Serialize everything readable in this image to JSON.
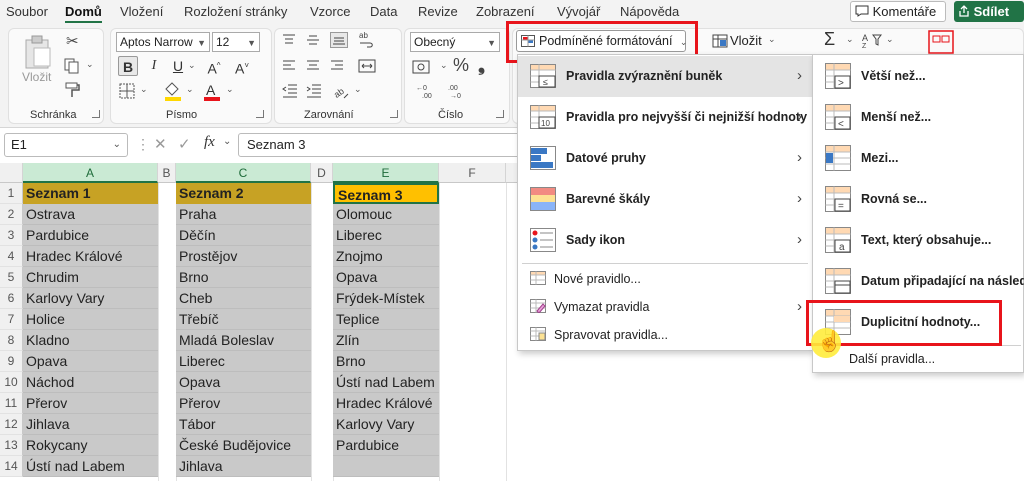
{
  "menubar": {
    "tabs": [
      "Soubor",
      "Domů",
      "Vložení",
      "Rozložení stránky",
      "Vzorce",
      "Data",
      "Revize",
      "Zobrazení",
      "Vývojář",
      "Nápověda"
    ],
    "active_tab": "Domů",
    "comments": "Komentáře",
    "share": "Sdílet"
  },
  "ribbon": {
    "groups": {
      "clipboard": "Schránka",
      "font": "Písmo",
      "alignment": "Zarovnání",
      "number": "Číslo"
    },
    "paste_label": "Vložit",
    "font_name": "Aptos Narrow",
    "font_size": "12",
    "number_format": "Obecný",
    "conditional_formatting": "Podmíněné formátování",
    "insert": "Vložit",
    "percent": "%"
  },
  "formula_bar": {
    "name_box": "E1",
    "fx": "fx",
    "content": "Seznam 3"
  },
  "columns": [
    "A",
    "B",
    "C",
    "D",
    "E",
    "F"
  ],
  "rows": [
    "1",
    "2",
    "3",
    "4",
    "5",
    "6",
    "7",
    "8",
    "9",
    "10",
    "11",
    "12",
    "13",
    "14"
  ],
  "list1": [
    "Seznam 1",
    "Ostrava",
    "Pardubice",
    "Hradec Králové",
    "Chrudim",
    "Karlovy Vary",
    "Holice",
    "Kladno",
    "Opava",
    "Náchod",
    "Přerov",
    "Jihlava",
    "Rokycany",
    "Ústí nad Labem"
  ],
  "list2": [
    "Seznam 2",
    "Praha",
    "Děčín",
    "Prostějov",
    "Brno",
    "Cheb",
    "Třebíč",
    "Mladá Boleslav",
    "Liberec",
    "Opava",
    "Přerov",
    "Tábor",
    "České Budějovice",
    "Jihlava"
  ],
  "list3": [
    "Seznam 3",
    "Olomouc",
    "Liberec",
    "Znojmo",
    "Opava",
    "Frýdek-Místek",
    "Teplice",
    "Zlín",
    "Brno",
    "Ústí nad Labem",
    "Hradec Králové",
    "Karlovy Vary",
    "Pardubice"
  ],
  "cf_menu": {
    "items": [
      {
        "label": "Pravidla zvýraznění buněk",
        "has_submenu": true,
        "highlighted": true
      },
      {
        "label": "Pravidla pro nejvyšší či nejnižší hodnoty",
        "has_submenu": true
      },
      {
        "label": "Datové pruhy",
        "has_submenu": true
      },
      {
        "label": "Barevné škály",
        "has_submenu": true
      },
      {
        "label": "Sady ikon",
        "has_submenu": true
      }
    ],
    "actions": [
      {
        "label": "Nové pravidlo..."
      },
      {
        "label": "Vymazat pravidla",
        "has_submenu": true
      },
      {
        "label": "Spravovat pravidla..."
      }
    ]
  },
  "highlight_submenu": {
    "items": [
      {
        "label": "Větší než..."
      },
      {
        "label": "Menší než..."
      },
      {
        "label": "Mezi..."
      },
      {
        "label": "Rovná se..."
      },
      {
        "label": "Text, který obsahuje..."
      },
      {
        "label": "Datum připadající na následující..."
      },
      {
        "label": "Duplicitní hodnoty...",
        "selected": true
      }
    ],
    "more": "Další pravidla..."
  },
  "colors": {
    "accent": "#217346",
    "highlight_red": "#e8141b",
    "header1_fill": "#c7a224",
    "header3_fill": "#ffc000",
    "data_fill": "#c9c9c9"
  }
}
